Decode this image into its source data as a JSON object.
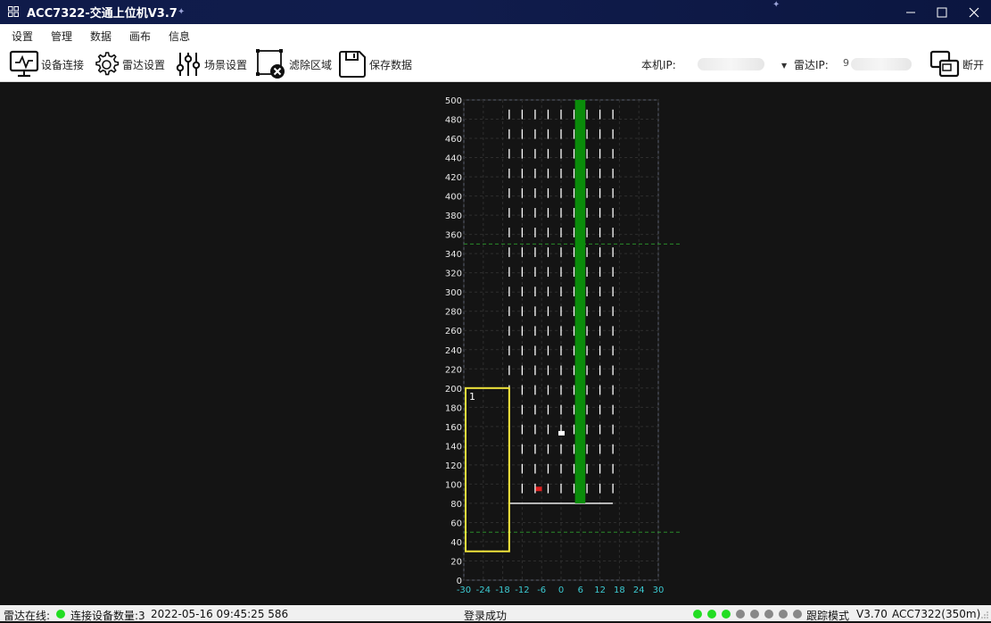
{
  "window": {
    "title": "ACC7322-交通上位机V3.7"
  },
  "menu": [
    "设置",
    "管理",
    "数据",
    "画布",
    "信息"
  ],
  "toolbar": {
    "connect": "设备连接",
    "radar_settings": "雷达设置",
    "scene_settings": "场景设置",
    "filter_region": "滤除区域",
    "save_data": "保存数据",
    "local_ip_label": "本机IP:",
    "radar_ip_label": "雷达IP:",
    "radar_ip_prefix": "9",
    "disconnect": "断开"
  },
  "canvas": {
    "y_ticks": [
      "500",
      "480",
      "460",
      "440",
      "420",
      "400",
      "380",
      "360",
      "340",
      "320",
      "300",
      "280",
      "260",
      "240",
      "220",
      "200",
      "180",
      "160",
      "140",
      "120",
      "100",
      "80",
      "60",
      "40",
      "20",
      "0"
    ],
    "x_ticks": [
      "-30",
      "-24",
      "-18",
      "-12",
      "-6",
      "0",
      "6",
      "12",
      "18",
      "24",
      "30"
    ],
    "zone_label": "1",
    "colors": {
      "green_lane": "#0a8c0a",
      "zone": "#f2e63c",
      "grid": "#2e2e2e",
      "trigger_line": "#2a8a2a",
      "x_tick_text": "#3ccad2",
      "target_red": "#e02020",
      "target_white": "#ffffff"
    },
    "targets": [
      {
        "name": "target-red",
        "x": -7,
        "y": 95,
        "color": "red"
      },
      {
        "name": "target-white",
        "x": 0,
        "y": 153,
        "color": "white"
      }
    ]
  },
  "status": {
    "radar_online_label": "雷达在线:",
    "device_count": "连接设备数量:3",
    "timestamp": "2022-05-16 09:45:25 586",
    "login": "登录成功",
    "indicator_colors": [
      "#22dd22",
      "#22dd22",
      "#22dd22",
      "#888888",
      "#888888",
      "#888888",
      "#888888",
      "#888888"
    ],
    "mode": "跟踪模式",
    "version": "V3.70",
    "device": "ACC7322(350m)"
  }
}
